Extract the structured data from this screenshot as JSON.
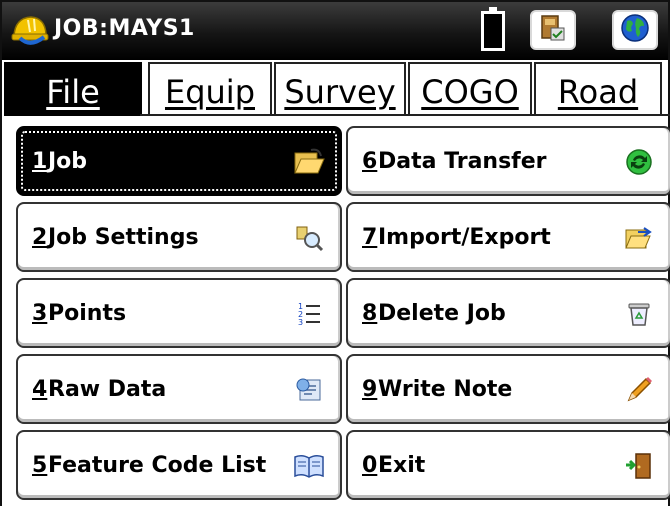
{
  "titlebar": {
    "title": "JOB:MAYS1",
    "icons": [
      "hardhat-logo-icon",
      "battery-icon",
      "instrument-status-icon",
      "globe-icon"
    ]
  },
  "tabs": [
    {
      "label": "File",
      "active": true
    },
    {
      "label": "Equip",
      "active": false
    },
    {
      "label": "Survey",
      "active": false
    },
    {
      "label": "COGO",
      "active": false
    },
    {
      "label": "Road",
      "active": false
    }
  ],
  "menu": {
    "left": [
      {
        "num": "1",
        "label": "Job",
        "icon": "folder-open-icon",
        "active": true
      },
      {
        "num": "2",
        "label": "Job Settings",
        "icon": "settings-magnifier-icon",
        "active": false
      },
      {
        "num": "3",
        "label": "Points",
        "icon": "numbered-list-icon",
        "active": false
      },
      {
        "num": "4",
        "label": "Raw Data",
        "icon": "raw-data-icon",
        "active": false
      },
      {
        "num": "5",
        "label": "Feature Code List",
        "icon": "book-icon",
        "active": false
      }
    ],
    "right": [
      {
        "num": "6",
        "label": "Data Transfer",
        "icon": "sync-icon",
        "active": false
      },
      {
        "num": "7",
        "label": "Import/Export",
        "icon": "folder-export-icon",
        "active": false
      },
      {
        "num": "8",
        "label": "Delete Job",
        "icon": "recycle-bin-icon",
        "active": false
      },
      {
        "num": "9",
        "label": "Write Note",
        "icon": "pencil-icon",
        "active": false
      },
      {
        "num": "0",
        "label": "Exit",
        "icon": "exit-door-icon",
        "active": false
      }
    ]
  }
}
